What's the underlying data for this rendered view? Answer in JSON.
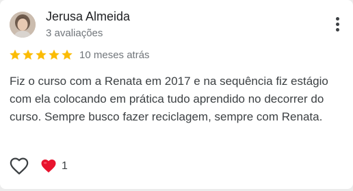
{
  "review": {
    "author_name": "Jerusa Almeida",
    "author_reviews": "3 avaliações",
    "rating": 5,
    "rating_max": 5,
    "time_ago": "10 meses atrás",
    "text": "Fiz o curso com a Renata em 2017 e na sequência fiz estágio com ela colocando em prática tudo aprendido no decorrer do curso. Sempre busco fazer reciclagem, sempre com Renata.",
    "reaction_count": "1"
  },
  "colors": {
    "star": "#fbbc04",
    "heart": "#e8142e",
    "text_primary": "#202124",
    "text_secondary": "#70757a"
  },
  "icons": {
    "menu": "more-vert-icon",
    "like": "heart-outline-icon",
    "reaction": "heart-filled-icon"
  }
}
